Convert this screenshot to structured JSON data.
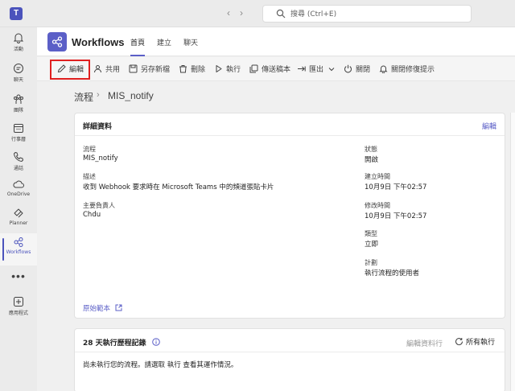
{
  "search": {
    "placeholder": "搜尋 (Ctrl+E)"
  },
  "rail": {
    "items": [
      {
        "label": "活動"
      },
      {
        "label": "聊天"
      },
      {
        "label": "團隊"
      },
      {
        "label": "行事曆"
      },
      {
        "label": "通話"
      },
      {
        "label": "OneDrive"
      },
      {
        "label": "Planner"
      },
      {
        "label": "Workflows"
      },
      {
        "label": "應用程式"
      }
    ],
    "more": "•••"
  },
  "app": {
    "name": "Workflows",
    "tabs": [
      {
        "label": "首頁"
      },
      {
        "label": "建立"
      },
      {
        "label": "聊天"
      }
    ]
  },
  "toolbar": {
    "edit": "編輯",
    "share": "共用",
    "save_as": "另存新檔",
    "delete": "刪除",
    "run": "執行",
    "copy_template": "傳送稿本",
    "export": "匯出",
    "turn_off": "關閉",
    "turn_off_repair": "關閉修復提示"
  },
  "breadcrumb": {
    "root": "流程",
    "separator": "›",
    "current": "MIS_notify"
  },
  "details": {
    "title": "詳細資料",
    "edit_link": "編輯",
    "flow_label": "流程",
    "flow_value": "MIS_notify",
    "desc_label": "描述",
    "desc_value": "收到 Webhook 要求時在 Microsoft Teams 中的頻道張貼卡片",
    "owner_label": "主要負責人",
    "owner_value": "Chdu",
    "status_label": "狀態",
    "status_value": "開啟",
    "created_label": "建立時間",
    "created_value": "10月9日 下午02:57",
    "modified_label": "修改時間",
    "modified_value": "10月9日 下午02:57",
    "type_label": "類型",
    "type_value": "立即",
    "plan_label": "計劃",
    "plan_value": "執行流程的使用者",
    "original_template": "原始範本"
  },
  "history": {
    "title": "28 天執行歷程記錄",
    "edit_columns": "編輯資料行",
    "all_runs": "所有執行",
    "empty_message": "尚未執行您的流程。請選取 執行 查看其運作情況。"
  }
}
